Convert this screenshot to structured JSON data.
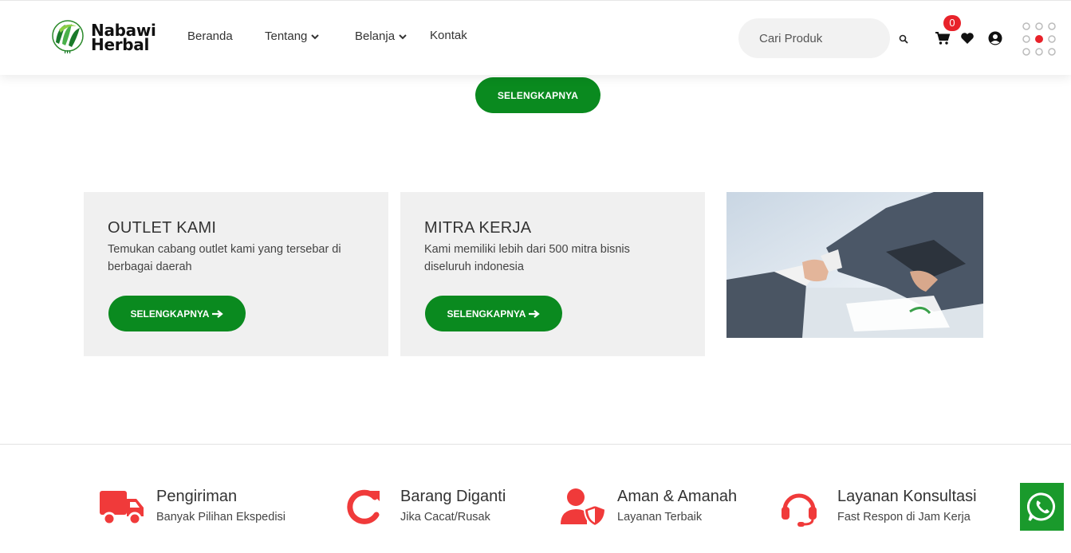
{
  "header": {
    "logo_line1": "Nabawi",
    "logo_line2": "Herbal",
    "nav": [
      {
        "label": "Beranda"
      },
      {
        "label": "Tentang"
      },
      {
        "label": "Belanja"
      },
      {
        "label": "Kontak"
      }
    ],
    "search_placeholder": "Cari Produk",
    "cart_count": "0"
  },
  "top_button": {
    "label": "SELENGKAPNYA"
  },
  "cards": [
    {
      "title": "OUTLET KAMI",
      "desc": "Temukan cabang outlet kami yang tersebar di berbagai daerah",
      "button": "SELENGKAPNYA"
    },
    {
      "title": "MITRA KERJA",
      "desc": "Kami memiliki lebih dari 500 mitra bisnis diseluruh indonesia",
      "button": "SELENGKAPNYA"
    }
  ],
  "features": [
    {
      "icon": "truck-icon",
      "title": "Pengiriman",
      "sub": "Banyak Pilihan Ekspedisi"
    },
    {
      "icon": "redo-icon",
      "title": "Barang Diganti",
      "sub": "Jika Cacat/Rusak"
    },
    {
      "icon": "user-shield-icon",
      "title": "Aman & Amanah",
      "sub": "Layanan Terbaik"
    },
    {
      "icon": "headset-icon",
      "title": "Layanan Konsultasi",
      "sub": "Fast Respon di Jam Kerja"
    }
  ],
  "colors": {
    "primary": "#0a8a1f",
    "accent": "#f03a3a",
    "badge": "#e8222a",
    "card_bg": "#f0f0f0"
  }
}
